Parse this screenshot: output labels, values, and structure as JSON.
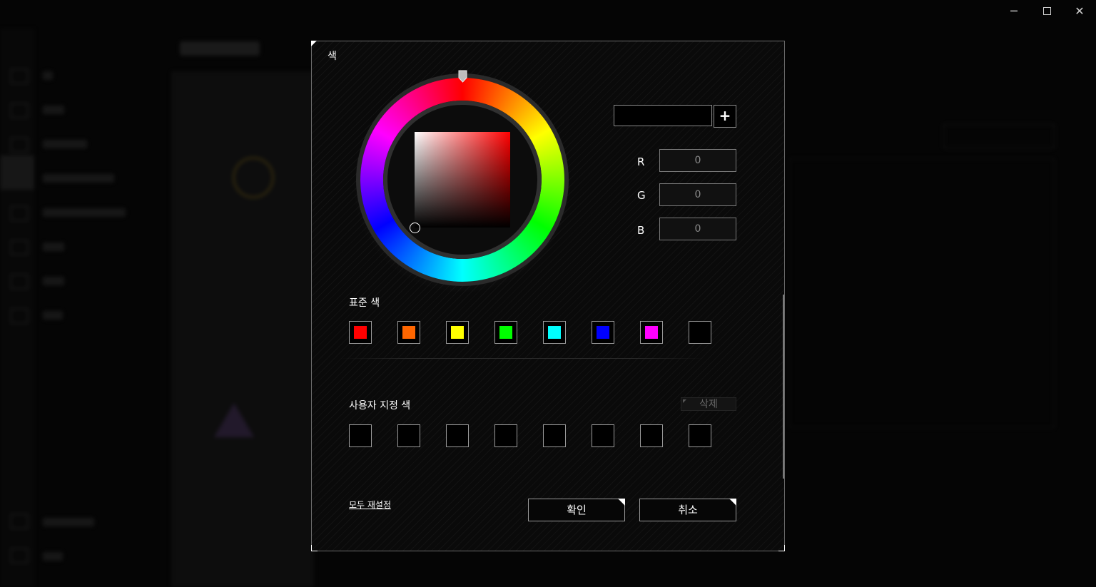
{
  "window": {
    "minimize_label": "─",
    "close_label": "✕"
  },
  "dialog": {
    "title": "색",
    "hex_value": "",
    "add_label": "+",
    "rgb": [
      {
        "label": "R",
        "value": "0"
      },
      {
        "label": "G",
        "value": "0"
      },
      {
        "label": "B",
        "value": "0"
      }
    ],
    "standard_label": "표준 색",
    "standard_colors": [
      "#ff0000",
      "#ff6600",
      "#ffff00",
      "#00ff00",
      "#00ffff",
      "#0000ff",
      "#ff00ff",
      ""
    ],
    "custom_label": "사용자 지정 색",
    "delete_label": "삭제",
    "reset_label": "모두 재설정",
    "ok_label": "확인",
    "cancel_label": "취소"
  },
  "colors": {
    "selected_hue": "#ff0000",
    "accent_border": "#9a9a9a"
  }
}
